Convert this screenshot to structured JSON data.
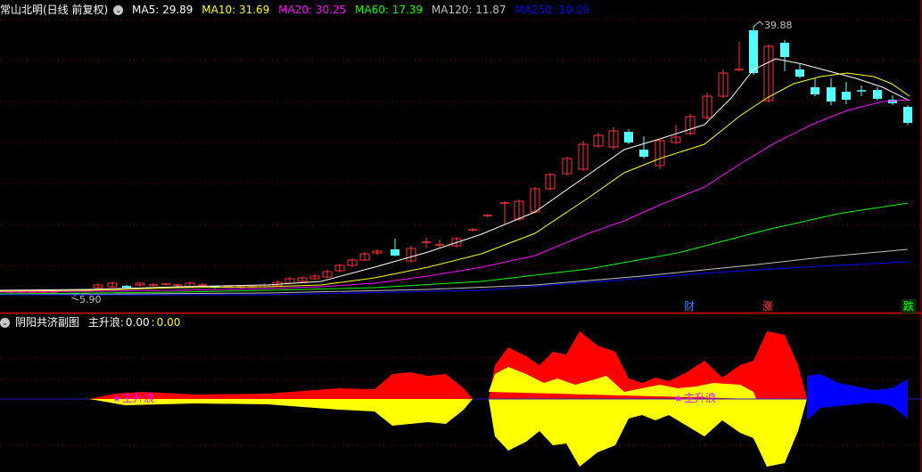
{
  "main_panel": {
    "title": "常山北明(日线 前复权)",
    "ma": [
      {
        "label": "MA5: 29.89",
        "color": "#ffffff"
      },
      {
        "label": "MA10: 31.69",
        "color": "#ffff00"
      },
      {
        "label": "MA20: 30.25",
        "color": "#ff00ff"
      },
      {
        "label": "MA60: 17.39",
        "color": "#00ff00"
      },
      {
        "label": "MA120: 11.87",
        "color": "#c0c0c0"
      },
      {
        "label": "MA250: 10.09",
        "color": "#0000ff"
      }
    ],
    "high_label": "39.88",
    "low_label": "5.90",
    "tags": [
      {
        "label": "财",
        "color": "#4080ff",
        "bg": "#000066"
      },
      {
        "label": "涨",
        "color": "#ff4040",
        "bg": "#330000"
      },
      {
        "label": "跌",
        "color": "#00ff00",
        "bg": "#003300"
      }
    ]
  },
  "sub_panel": {
    "title": "阴阳共济副图",
    "indicator_label": "主升浪:",
    "value1": "0.00",
    "value2": "0.00",
    "markers": [
      "主升浪",
      "主升浪"
    ]
  },
  "colors": {
    "bg": "#000000",
    "grid": "#800000",
    "up": "#ff3232",
    "down": "#54ffff",
    "red_fill": "#ff0000",
    "yellow_fill": "#ffff00",
    "blue_fill": "#0000ff"
  }
}
